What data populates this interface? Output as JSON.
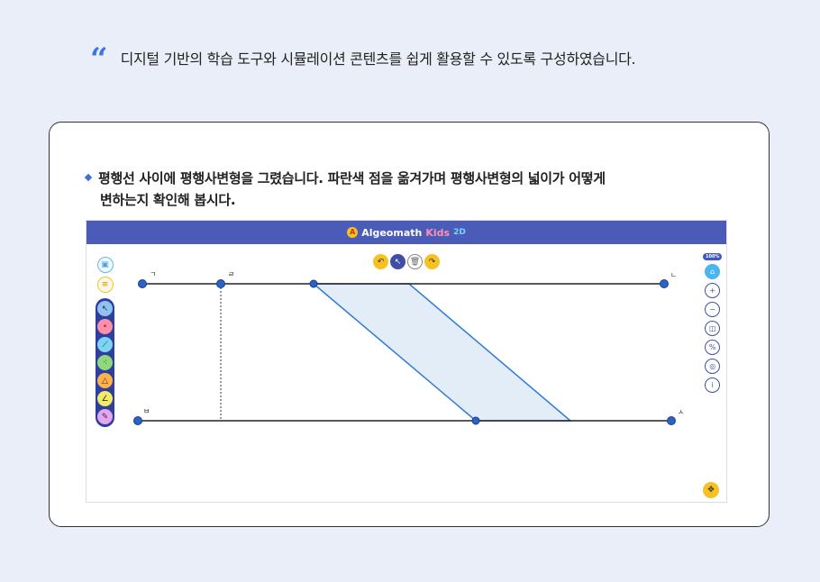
{
  "intro": {
    "quote_icon": "quote-icon",
    "text": "디지털 기반의 학습 도구와 시뮬레이션 콘텐츠를 쉽게 활용할 수 있도록 구성하였습니다."
  },
  "instruction": {
    "line1": "평행선 사이에 평행사변형을 그렸습니다. 파란색 점을 옮겨가며 평행사변형의 넓이가 어떻게",
    "line2": "변하는지 확인해 봅시다."
  },
  "app": {
    "logo_text": "Algeomath",
    "logo_kids": "Kids",
    "logo_2d": "2D",
    "zoom_level": "100%",
    "colors": {
      "header": "#4b5bb8",
      "accent": "#3f74e6",
      "shape_fill": "#e3edf8",
      "point": "#2a62c9"
    }
  },
  "geometry_labels": {
    "top_left": "ㄱ",
    "top_mid": "ㄹ",
    "top_right": "ㄴ",
    "bottom_left": "ㅂ",
    "bottom_right": "ㅅ"
  }
}
